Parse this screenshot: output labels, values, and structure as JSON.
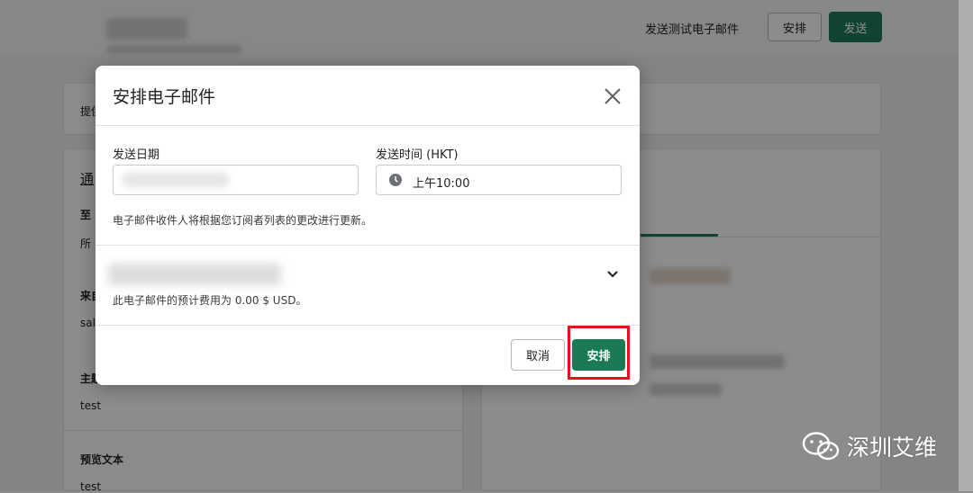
{
  "background": {
    "top_link": "发送测试电子邮件",
    "schedule_label": "安排",
    "send_label": "发送",
    "card_preview_label": "提供",
    "section_notify": "通",
    "to_label": "至",
    "to_value": "所",
    "from_label": "来自",
    "from_value": "sal",
    "subject_label": "主题",
    "subject_value": "test",
    "preview_label": "预览文本",
    "preview_value": "test"
  },
  "modal": {
    "title": "安排电子邮件",
    "date_label": "发送日期",
    "time_label": "发送时间 (HKT)",
    "time_value": "上午10:00",
    "help_text": "电子邮件收件人将根据您订阅者列表的更改进行更新。",
    "cost_text": "此电子邮件的预计费用为 0.00 $ USD。",
    "cancel_label": "取消",
    "schedule_label": "安排"
  },
  "watermark": {
    "text": "深圳艾维"
  },
  "colors": {
    "primary": "#1a7a56",
    "highlight": "#e3131b"
  }
}
